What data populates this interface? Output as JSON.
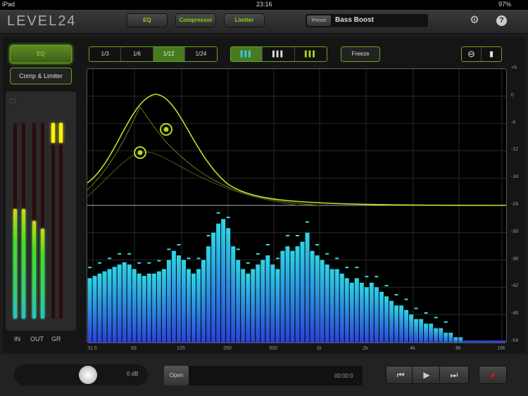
{
  "status": {
    "device": "iPad",
    "time": "23:16",
    "battery": "97%"
  },
  "header": {
    "logo": "LEVEL24",
    "tabs": [
      "EQ",
      "Compressor",
      "Limiter"
    ],
    "preset_tag": "Preset",
    "preset_name": "Bass Boost",
    "icons": [
      "gear-icon",
      "help-icon"
    ]
  },
  "left": {
    "eq_label": "EQ",
    "comp_label": "Comp & Limiter",
    "meter_labels": [
      "IN",
      "OUT",
      "GR"
    ],
    "meter_levels": {
      "in_l": 0.56,
      "in_r": 0.56,
      "out_l": 0.5,
      "out_r": 0.46,
      "gr_l": 0.95,
      "gr_r": 0.95
    }
  },
  "toolbar": {
    "resolution": [
      "1/3",
      "1/6",
      "1/12",
      "1/24"
    ],
    "resolution_selected": "1/12",
    "freeze_label": "Freeze",
    "display_modes": [
      "spectrum-cyan",
      "spectrum-white",
      "spectrum-green"
    ]
  },
  "chart_data": {
    "type": "bar",
    "y_ticks": [
      "+6",
      "0",
      "-6",
      "-12",
      "-18",
      "-24",
      "-30",
      "-36",
      "-42",
      "-48",
      "-54"
    ],
    "ylim": [
      -54,
      6
    ],
    "x_ticks": [
      "31.5",
      "63",
      "125",
      "250",
      "500",
      "1k",
      "2k",
      "4k",
      "8k",
      "16k"
    ],
    "spectrum_db": [
      -40,
      -39.5,
      -39,
      -38.5,
      -38,
      -37.5,
      -37,
      -36.5,
      -37,
      -38,
      -39,
      -39.5,
      -39,
      -39,
      -38.5,
      -38,
      -36,
      -34,
      -35,
      -36,
      -38,
      -39,
      -38,
      -36,
      -33,
      -30,
      -28,
      -27,
      -29,
      -33,
      -36,
      -38,
      -39,
      -38,
      -37,
      -36,
      -35,
      -37,
      -38,
      -34,
      -33,
      -34,
      -33,
      -32,
      -30,
      -34,
      -35,
      -36,
      -37,
      -38,
      -38,
      -39,
      -40,
      -41,
      -40,
      -41,
      -42,
      -41,
      -42,
      -43,
      -44,
      -45,
      -46,
      -46,
      -47,
      -48,
      -49,
      -49,
      -50,
      -50,
      -51,
      -51,
      -52,
      -52,
      -53,
      -53,
      -54,
      -54,
      -54,
      -54,
      -54,
      -54,
      -54,
      -54,
      -54
    ],
    "peak_hold_offset_db": 2.5,
    "eq_flat_db": -24
  },
  "bottom": {
    "gain": "0 dB",
    "open_label": "Open",
    "time": "00:00:0"
  },
  "colors": {
    "accent": "#8fd11c",
    "spectrum_top": "#2fd6e6",
    "spectrum_bottom": "#2a3fd6",
    "record": "#e0101a"
  }
}
